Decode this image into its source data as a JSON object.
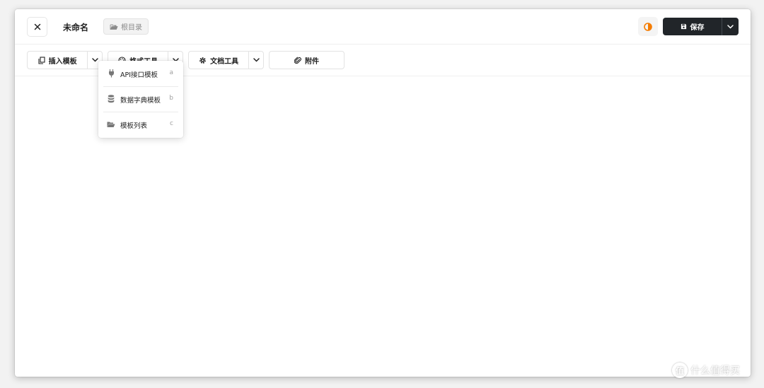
{
  "header": {
    "title": "未命名",
    "folder_label": "根目录",
    "save_label": "保存"
  },
  "toolbar": {
    "insert_template": "插入模板",
    "format_tools": "格式工具",
    "doc_tools": "文档工具",
    "attachment": "附件"
  },
  "dropdown": {
    "items": [
      {
        "icon": "plug-icon",
        "label": "API接口模板",
        "shortcut": "a"
      },
      {
        "icon": "database-icon",
        "label": "数据字典模板",
        "shortcut": "b"
      },
      {
        "icon": "folder-open-icon",
        "label": "模板列表",
        "shortcut": "c"
      }
    ]
  },
  "colors": {
    "accent": "#f57c00",
    "save_bg": "#212529",
    "border": "#e3e3e3"
  },
  "watermark": {
    "badge": "值",
    "text": "什么值得买"
  }
}
